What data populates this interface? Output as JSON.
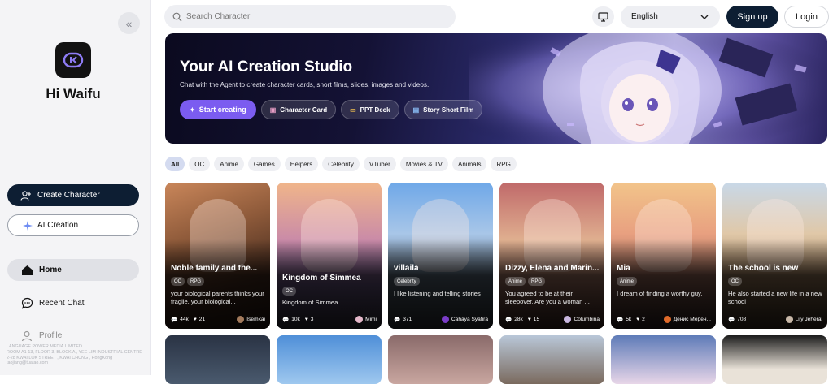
{
  "sidebar": {
    "brand": "Hi Waifu",
    "create_character": "Create Character",
    "ai_creation": "AI Creation",
    "nav": [
      {
        "label": "Home"
      },
      {
        "label": "Recent Chat"
      },
      {
        "label": "Profile"
      }
    ],
    "company_name": "LANGUAGE POWER MEDIA LIMITED",
    "company_address": "ROOM A1-13, FLOOR 3, BLOCK A , YEE LIM INDUSTRIAL CENTRE 2-28 KWAI LOK STREET , KWAI CHUNG , HongKong",
    "company_email": "taojiang@tuatao.com"
  },
  "topbar": {
    "search_placeholder": "Search Character",
    "language": "English",
    "signup": "Sign up",
    "login": "Login"
  },
  "hero": {
    "title": "Your AI Creation Studio",
    "subtitle": "Chat with the Agent to create character cards, short films, slides, images and videos.",
    "buttons": {
      "start": "Start creating",
      "card": "Character Card",
      "ppt": "PPT Deck",
      "film": "Story Short Film"
    }
  },
  "categories": [
    "All",
    "OC",
    "Anime",
    "Games",
    "Helpers",
    "Celebrity",
    "VTuber",
    "Movies & TV",
    "Animals",
    "RPG"
  ],
  "cards": [
    {
      "name": "Noble family and the...",
      "tags": [
        "OC",
        "RPG"
      ],
      "desc": "your biological parents thinks your fragile, your biological...",
      "chats": "44k",
      "likes": "21",
      "author": "Isemkai",
      "avatar_color": "#a37a5c"
    },
    {
      "name": "Kingdom of Simmea",
      "tags": [
        "OC"
      ],
      "desc": "Kingdom of Simmea",
      "chats": "10k",
      "likes": "3",
      "author": "Mimi",
      "avatar_color": "#e3b7c9"
    },
    {
      "name": "villaila",
      "tags": [
        "Celebrity"
      ],
      "desc": "I like listening and telling stories",
      "chats": "371",
      "likes": "",
      "author": "Cahaya Syafira",
      "avatar_color": "#7a3cc8",
      "avatar_letter": "C"
    },
    {
      "name": "Dizzy, Elena and Marin...",
      "tags": [
        "Anime",
        "RPG"
      ],
      "desc": "You agreed to be at their sleepover. Are you a woman ...",
      "chats": "28k",
      "likes": "15",
      "author": "Columbina",
      "avatar_color": "#c9b7e0"
    },
    {
      "name": "Mia",
      "tags": [
        "Anime"
      ],
      "desc": "I dream of finding a worthy guy.",
      "chats": "5k",
      "likes": "2",
      "author": "Денис Мерен...",
      "avatar_color": "#e06a2a",
      "avatar_letter": "Д"
    },
    {
      "name": "The school is new",
      "tags": [
        "OC"
      ],
      "desc": "He also started a new life in a new school",
      "chats": "708",
      "likes": "",
      "author": "Lily Jeheral",
      "avatar_color": "#c8b8a8"
    }
  ]
}
